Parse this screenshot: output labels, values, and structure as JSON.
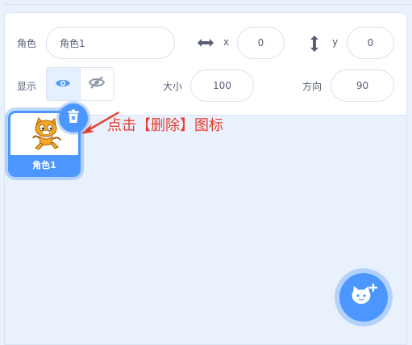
{
  "sprite_info": {
    "sprite_label": "角色",
    "sprite_name": "角色1",
    "x_label": "x",
    "x_value": "0",
    "y_label": "y",
    "y_value": "0",
    "show_label": "显示",
    "size_label": "大小",
    "size_value": "100",
    "direction_label": "方向",
    "direction_value": "90"
  },
  "sprite_list": {
    "items": [
      {
        "name": "角色1",
        "selected": true
      }
    ]
  },
  "annotation": {
    "text": "点击【删除】图标",
    "color": "#e43d30"
  },
  "colors": {
    "accent": "#4c97ff",
    "panel_bg": "#e9f1fc",
    "text": "#575e75"
  },
  "icons": {
    "x_axis": "horizontal-arrows-icon",
    "y_axis": "vertical-arrows-icon",
    "show": "eye-icon",
    "hide": "eye-slash-icon",
    "delete": "trash-icon",
    "add_sprite": "cat-plus-icon"
  }
}
